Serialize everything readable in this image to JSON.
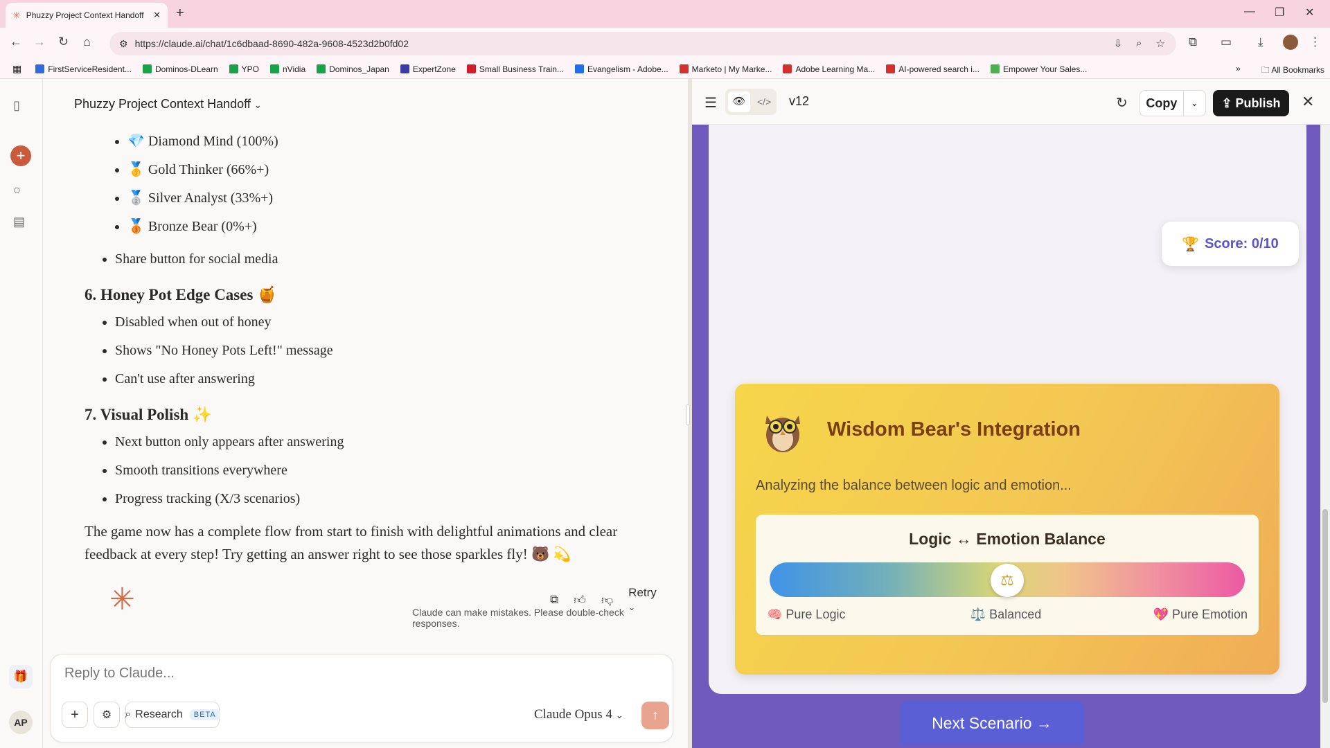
{
  "browser": {
    "tab_title": "Phuzzy Project Context Handoff",
    "url": "https://claude.ai/chat/1c6dbaad-8690-482a-9608-4523d2b0fd02",
    "bookmarks": [
      {
        "label": "FirstServiceResident...",
        "color": "#2d6cdf"
      },
      {
        "label": "Dominos-DLearn",
        "color": "#16a34a"
      },
      {
        "label": "YPO",
        "color": "#16a34a"
      },
      {
        "label": "nVidia",
        "color": "#16a34a"
      },
      {
        "label": "Dominos_Japan",
        "color": "#16a34a"
      },
      {
        "label": "ExpertZone",
        "color": "#3b3ba8"
      },
      {
        "label": "Small Business Train...",
        "color": "#d11c2c"
      },
      {
        "label": "Evangelism - Adobe...",
        "color": "#1f6feb"
      },
      {
        "label": "Marketo | My Marke...",
        "color": "#d32f2f"
      },
      {
        "label": "Adobe Learning Ma...",
        "color": "#d32f2f"
      },
      {
        "label": "AI-powered search i...",
        "color": "#d32f2f"
      },
      {
        "label": "Empower Your Sales...",
        "color": "#4caf50"
      }
    ],
    "all_bookmarks": "All Bookmarks"
  },
  "chat": {
    "title": "Phuzzy Project Context Handoff",
    "badges": [
      {
        "icon": "💎",
        "text": "Diamond Mind (100%)"
      },
      {
        "icon": "🥇",
        "text": "Gold Thinker (66%+)"
      },
      {
        "icon": "🥈",
        "text": "Silver Analyst (33%+)"
      },
      {
        "icon": "🥉",
        "text": "Bronze Bear (0%+)"
      }
    ],
    "share_item": "Share button for social media",
    "section6": {
      "heading": "6. Honey Pot Edge Cases 🍯",
      "items": [
        "Disabled when out of honey",
        "Shows \"No Honey Pots Left!\" message",
        "Can't use after answering"
      ]
    },
    "section7": {
      "heading": "7. Visual Polish ✨",
      "items": [
        "Next button only appears after answering",
        "Smooth transitions everywhere",
        "Progress tracking (X/3 scenarios)"
      ]
    },
    "outro": "The game now has a complete flow from start to finish with delightful animations and clear feedback at every step! Try getting an answer right to see those sparkles fly! 🐻 💫",
    "retry_label": "Retry",
    "disclaimer": "Claude can make mistakes. Please double-check responses.",
    "composer": {
      "placeholder": "Reply to Claude...",
      "research_label": "Research",
      "beta_label": "BETA",
      "model": "Claude Opus 4"
    },
    "avatar_initials": "AP"
  },
  "artifact": {
    "version": "v12",
    "copy_label": "Copy",
    "publish_label": "Publish",
    "score": "Score: 0/10",
    "score_icon": "🏆",
    "wisdom": {
      "title": "Wisdom Bear's Integration",
      "analyzing": "Analyzing the balance between logic and emotion...",
      "balance_title": "Logic ↔ Emotion Balance",
      "balance_value": 0.5,
      "labels": {
        "logic": "🧠 Pure Logic",
        "balanced": "⚖️ Balanced",
        "emotion": "💖 Pure Emotion"
      }
    },
    "next_button": "Next Scenario →"
  }
}
